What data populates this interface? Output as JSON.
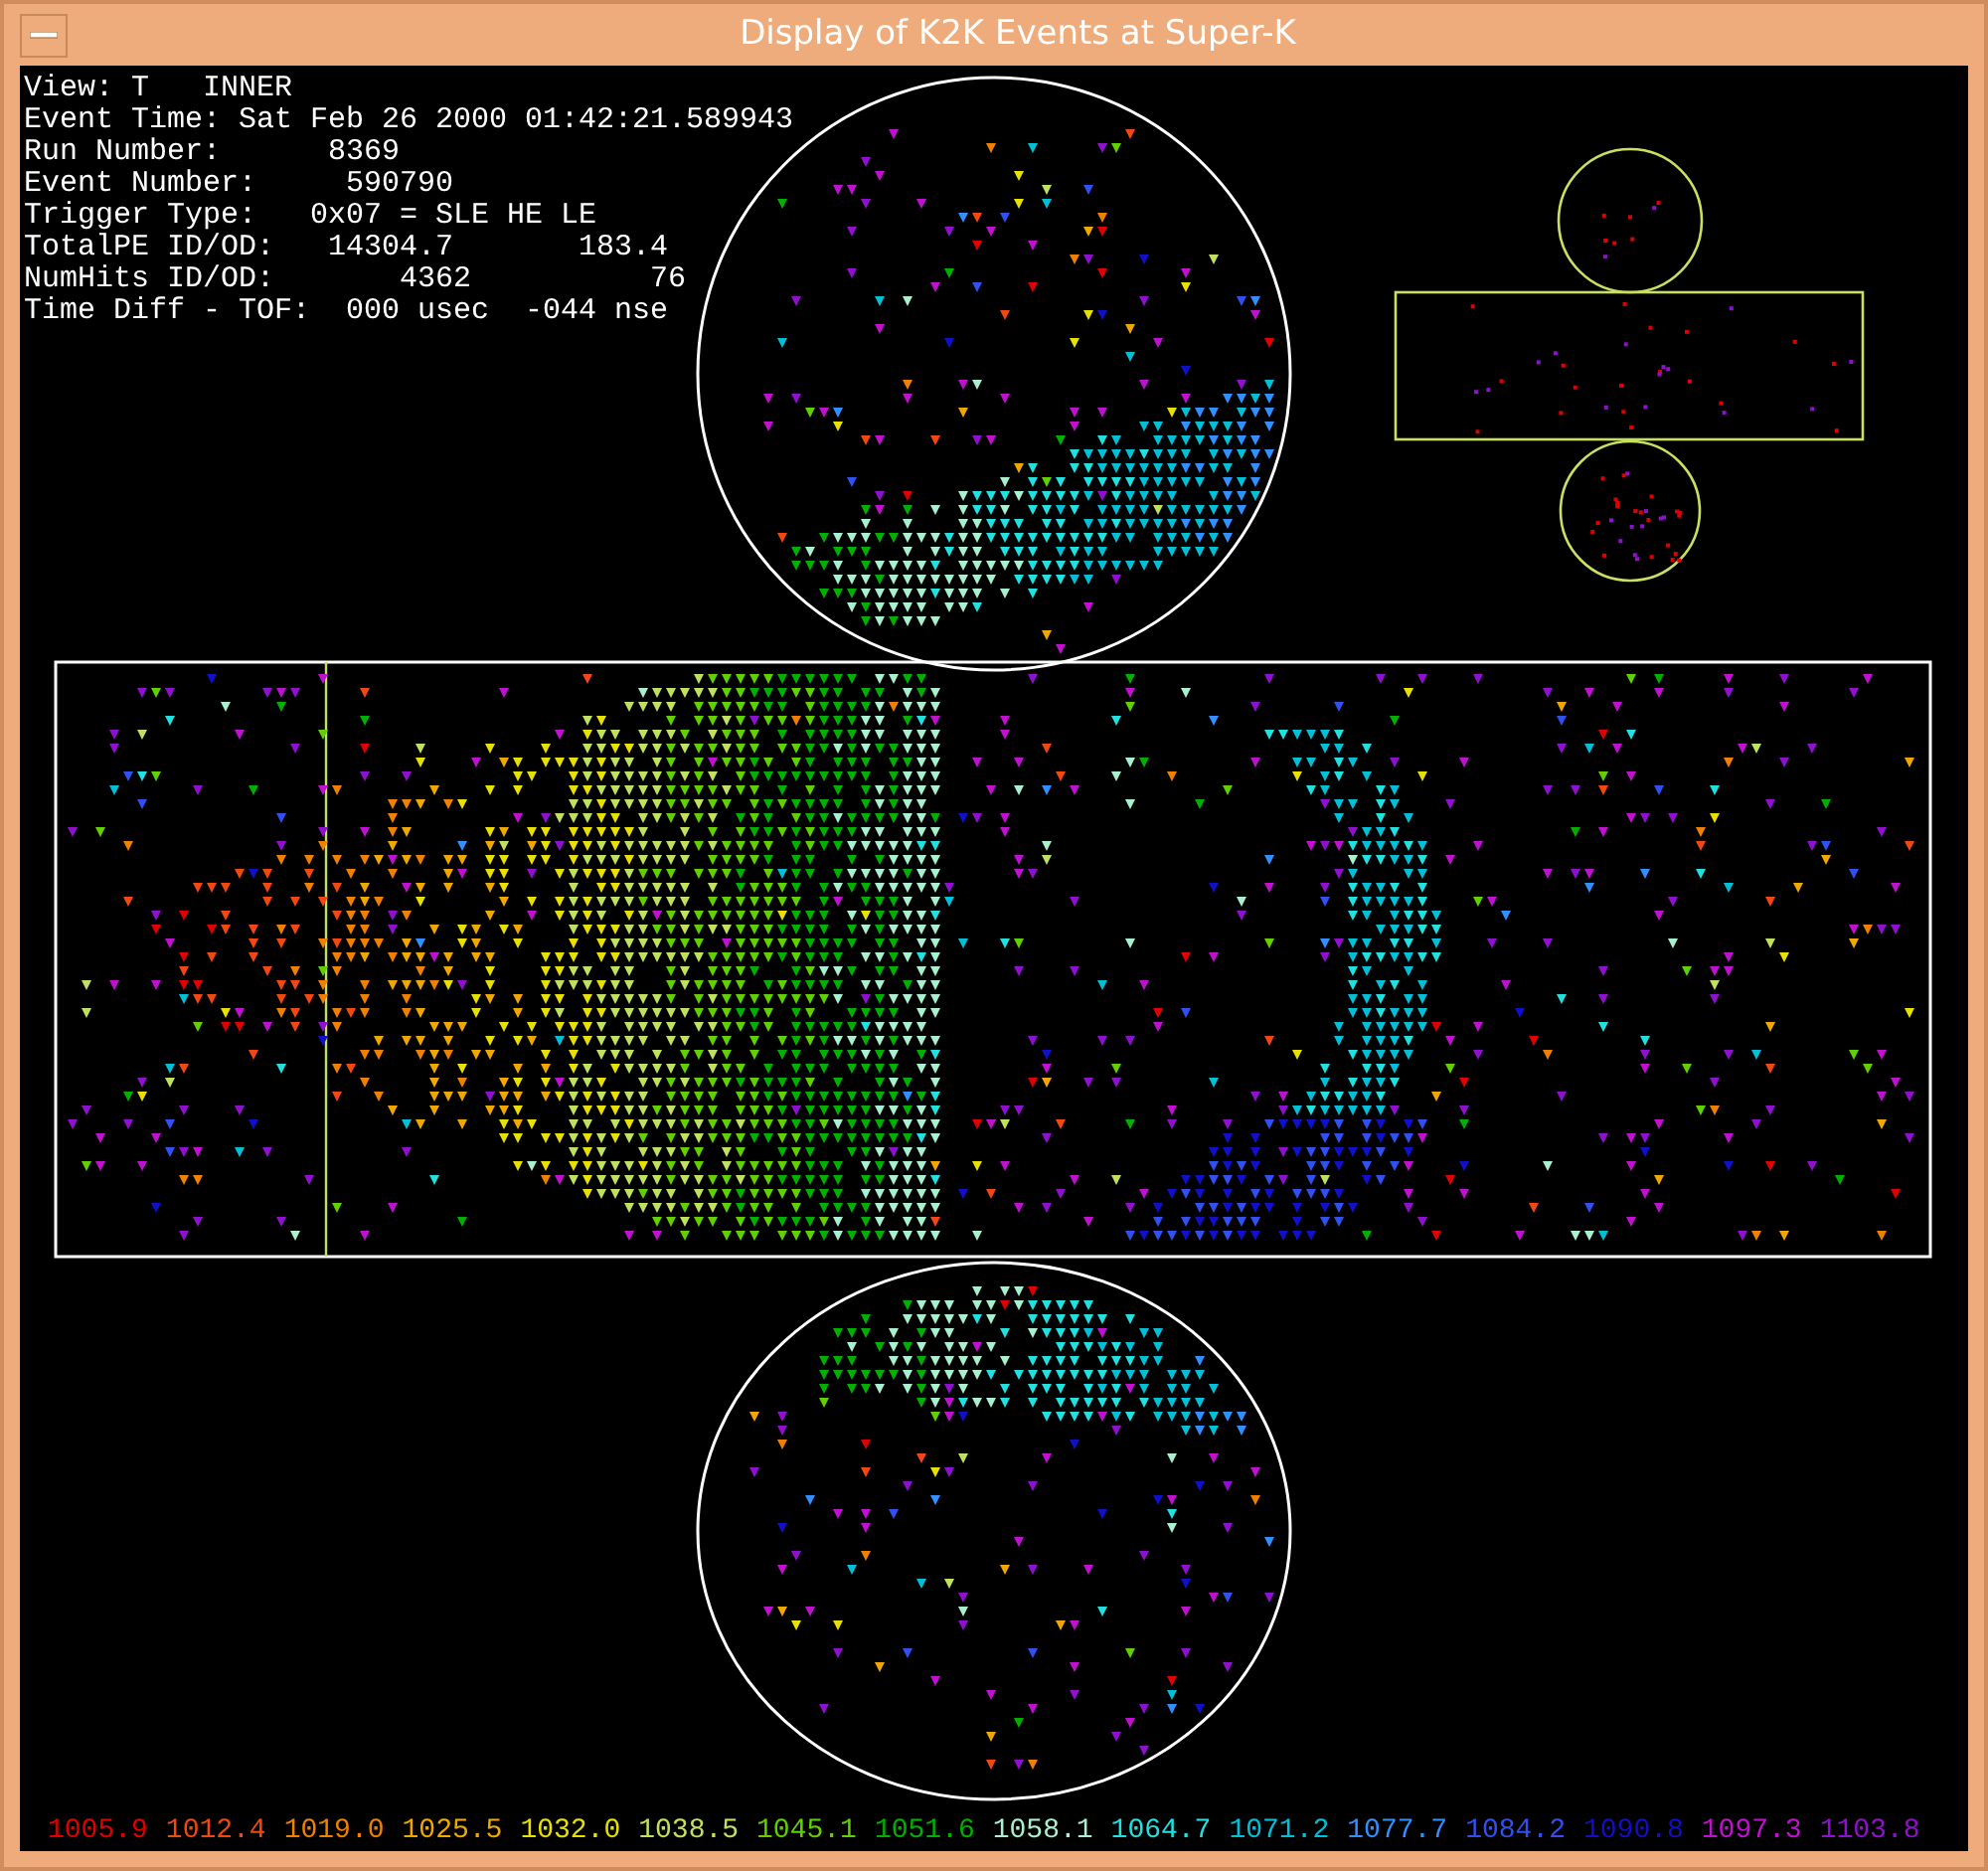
{
  "window": {
    "title": "Display of K2K Events at Super-K"
  },
  "info_lines": [
    "View: T   INNER",
    "Event Time: Sat Feb 26 2000 01:42:21.589943",
    "Run Number:      8369",
    "Event Number:     590790",
    "Trigger Type:   0x07 = SLE HE LE",
    "TotalPE ID/OD:   14304.7       183.4",
    "NumHits ID/OD:       4362          76",
    "Time Diff - TOF:  000 usec  -044 nse"
  ],
  "legend": [
    {
      "label": "1005.9",
      "color": "#e00000"
    },
    {
      "label": "1012.4",
      "color": "#f04810"
    },
    {
      "label": "1019.0",
      "color": "#f08000"
    },
    {
      "label": "1025.5",
      "color": "#f0a800"
    },
    {
      "label": "1032.0",
      "color": "#e8e000"
    },
    {
      "label": "1038.5",
      "color": "#c0e060"
    },
    {
      "label": "1045.1",
      "color": "#60d000"
    },
    {
      "label": "1051.6",
      "color": "#00b000"
    },
    {
      "label": "1058.1",
      "color": "#a8f0d0"
    },
    {
      "label": "1064.7",
      "color": "#20e0e0"
    },
    {
      "label": "1071.2",
      "color": "#00c0d8"
    },
    {
      "label": "1077.7",
      "color": "#3090ff"
    },
    {
      "label": "1084.2",
      "color": "#3050f0"
    },
    {
      "label": "1090.8",
      "color": "#1010c8"
    },
    {
      "label": "1097.3",
      "color": "#c010d0"
    },
    {
      "label": "1103.8",
      "color": "#9010d0"
    }
  ]
}
